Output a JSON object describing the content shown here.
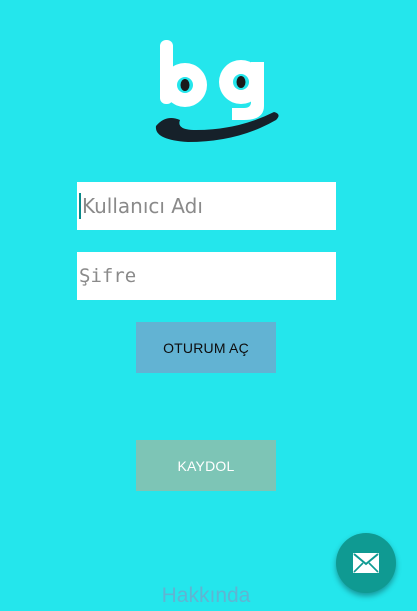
{
  "logo": {
    "text": "bg",
    "icon": "bg-smile-logo"
  },
  "login_form": {
    "username_placeholder": "Kullanıcı Adı",
    "password_placeholder": "Şifre",
    "login_button_label": "OTURUM AÇ"
  },
  "register_button_label": "KAYDOL",
  "about_link_label": "Hakkında",
  "fab": {
    "icon": "mail-icon"
  },
  "colors": {
    "background": "#24e6ec",
    "login_button": "#62b3d3",
    "register_button": "#7dc5b6",
    "fab": "#0f9a92",
    "about_link": "#5fb5d3"
  }
}
